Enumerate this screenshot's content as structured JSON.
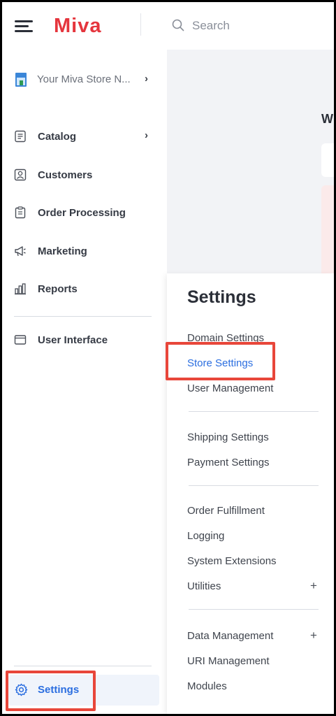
{
  "header": {
    "brand": "Miva",
    "search_placeholder": "Search"
  },
  "sidebar": {
    "store_name": "Your Miva Store N...",
    "items": [
      {
        "label": "Catalog",
        "icon": "catalog-icon",
        "has_chevron": true
      },
      {
        "label": "Customers",
        "icon": "customers-icon"
      },
      {
        "label": "Order Processing",
        "icon": "order-processing-icon"
      },
      {
        "label": "Marketing",
        "icon": "marketing-icon"
      },
      {
        "label": "Reports",
        "icon": "reports-icon"
      },
      {
        "label": "User Interface",
        "icon": "user-interface-icon"
      }
    ],
    "settings_label": "Settings"
  },
  "main": {
    "heading_fragment": "W"
  },
  "settings_menu": {
    "title": "Settings",
    "groups": [
      [
        "Domain Settings",
        "Store Settings",
        "User Management"
      ],
      [
        "Shipping Settings",
        "Payment Settings"
      ],
      [
        "Order Fulfillment",
        "Logging",
        "System Extensions",
        "Utilities"
      ],
      [
        "Data Management",
        "URI Management",
        "Modules"
      ]
    ],
    "active_item": "Store Settings",
    "expandable_symbol": "+"
  },
  "colors": {
    "accent": "#2b6ee0",
    "brand": "#e5353d",
    "highlight": "#e8463a"
  }
}
